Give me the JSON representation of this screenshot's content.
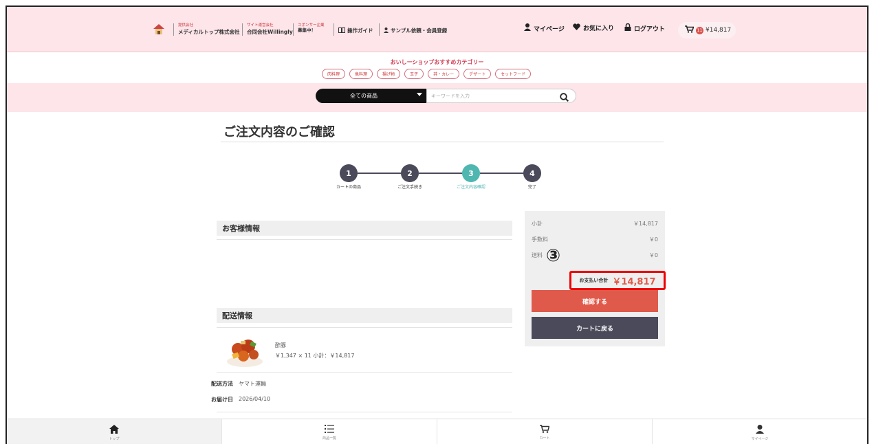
{
  "header": {
    "logo_text": "",
    "sponsor_small_1": "提供会社",
    "company_1": "メディカルトップ株式会社",
    "sponsor_small_2": "サイト運営会社",
    "company_2": "合同会社Willingly",
    "sponsor_small_3a": "スポンサー企業",
    "sponsor_small_3b": "募集中！",
    "guide": "操作ガイド",
    "sample": "サンプル依頼・会員登録",
    "nav": [
      {
        "label": "マイページ",
        "icon": "person-icon"
      },
      {
        "label": "お気に入り",
        "icon": "heart-icon"
      },
      {
        "label": "ログアウト",
        "icon": "lock-icon"
      }
    ],
    "cart_count": "11",
    "cart_total": "¥14,817"
  },
  "categories": {
    "title": "おいしーショップおすすめカテゴリー",
    "items": [
      "肉料理",
      "魚料理",
      "揚げ物",
      "玉子",
      "丼・カレー",
      "デザート",
      "セットフード"
    ]
  },
  "search": {
    "select_label": "全ての商品",
    "placeholder": "キーワードを入力"
  },
  "page": {
    "title": "ご注文内容のご確認"
  },
  "steps": [
    {
      "num": "1",
      "label": "カートの商品"
    },
    {
      "num": "2",
      "label": "ご注文手続き"
    },
    {
      "num": "3",
      "label": "ご注文内容確認"
    },
    {
      "num": "4",
      "label": "完了"
    }
  ],
  "customer": {
    "heading": "お客様情報"
  },
  "delivery": {
    "heading": "配送情報",
    "product_name": "酢豚",
    "product_info": "￥1,347 × 11  小計：￥14,817",
    "method_label": "配送方法",
    "method_value": "ヤマト運輸",
    "date_label": "お届け日",
    "date_value": "2026/04/10"
  },
  "summary": {
    "subtotal_label": "小計",
    "subtotal_value": "￥14,817",
    "fee_label": "手数料",
    "fee_value": "￥0",
    "shipping_label": "送料",
    "shipping_value": "￥0",
    "total_label": "お支払い合計",
    "total_value": "￥14,817",
    "confirm_button": "確認する",
    "back_button": "カートに戻る"
  },
  "annotation": "③",
  "bottom_nav": [
    {
      "label": "トップ"
    },
    {
      "label": "商品一覧"
    },
    {
      "label": "カート"
    },
    {
      "label": "マイページ"
    }
  ]
}
